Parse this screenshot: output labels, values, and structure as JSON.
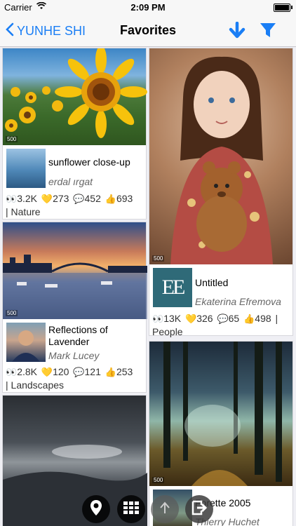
{
  "status_bar": {
    "carrier": "Carrier",
    "time": "2:09 PM"
  },
  "nav": {
    "back_label": "YUNHE SHI",
    "title": "Favorites",
    "icons": [
      "download-icon",
      "filter-icon"
    ],
    "accent": "#1a7ef5"
  },
  "photos": [
    {
      "title": "sunflower close-up",
      "author": "erdal ırgat",
      "views": "3.2K",
      "likes": "273",
      "comments": "452",
      "votes": "693",
      "category": "| Nature"
    },
    {
      "title": "Reflections of Lavender",
      "author": "Mark Lucey",
      "views": "2.8K",
      "likes": "120",
      "comments": "121",
      "votes": "253",
      "category": "| Landscapes"
    },
    {
      "title": "Untitled",
      "author": "Ekaterina Efremova",
      "views": "13K",
      "likes": "326",
      "comments": "65",
      "votes": "498",
      "category": "| People",
      "thumb_text": "EE"
    },
    {
      "title": "Forette 2005",
      "author": "Thierry Huchet"
    }
  ],
  "watermark": "500",
  "fab_icons": [
    "location-pin-icon",
    "grid-icon",
    "scroll-top-icon",
    "exit-icon"
  ]
}
